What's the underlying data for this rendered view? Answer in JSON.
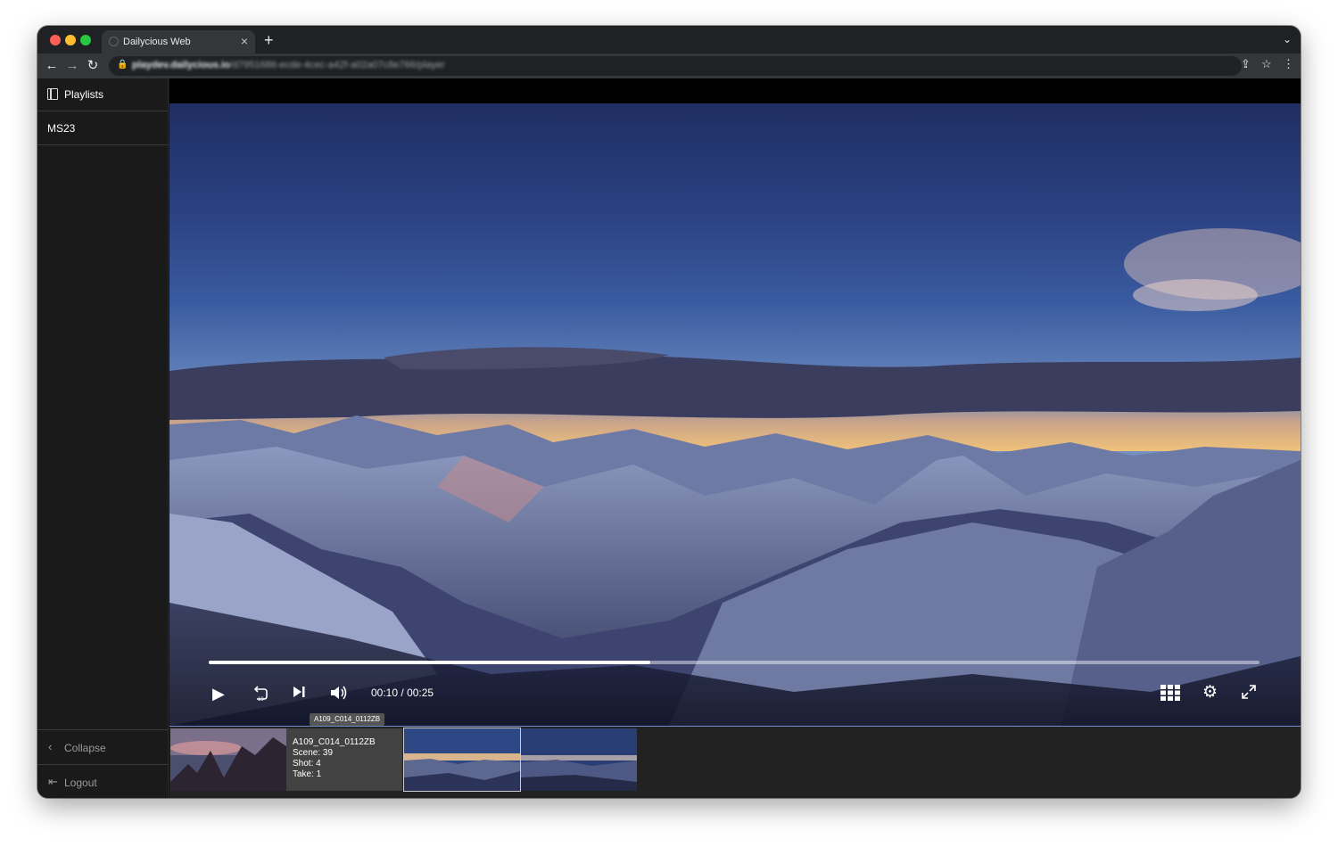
{
  "browser": {
    "tab_title": "Dailycious Web",
    "tab_close": "×",
    "new_tab": "+",
    "tab_menu": "⌄",
    "url_host": "playdev.dailycious.io",
    "url_path": "/d7951686-ecde-4cec-a42f-a02a07c8e766/player",
    "nav": {
      "back": "←",
      "forward": "→",
      "reload": "↻"
    },
    "actions": {
      "share": "⇪",
      "bookmark": "☆",
      "menu": "⋮"
    }
  },
  "sidebar": {
    "playlists_label": "Playlists",
    "items": [
      {
        "label": "MS23"
      }
    ],
    "collapse_label": "Collapse",
    "collapse_icon": "‹",
    "logout_label": "Logout",
    "logout_icon": "⇤"
  },
  "player": {
    "current_time": "00:10",
    "separator": "/",
    "duration": "00:25",
    "progress": 0.42,
    "icons": [
      "play-icon",
      "replay-10-icon",
      "skip-next-icon",
      "volume-icon",
      "grid-icon",
      "settings-icon",
      "fullscreen-icon"
    ],
    "replay_seconds": "10"
  },
  "filmstrip": {
    "tooltip": "A109_C014_0112ZB",
    "info": {
      "clip_name": "A109_C014_0112ZB",
      "scene": "Scene: 39",
      "shot": "Shot: 4",
      "take": "Take: 1"
    },
    "clip_count": 4
  },
  "colors": {
    "app_background": "#141414",
    "sidebar": "#1a1a1a",
    "accent_line": "#6f8ec7"
  }
}
